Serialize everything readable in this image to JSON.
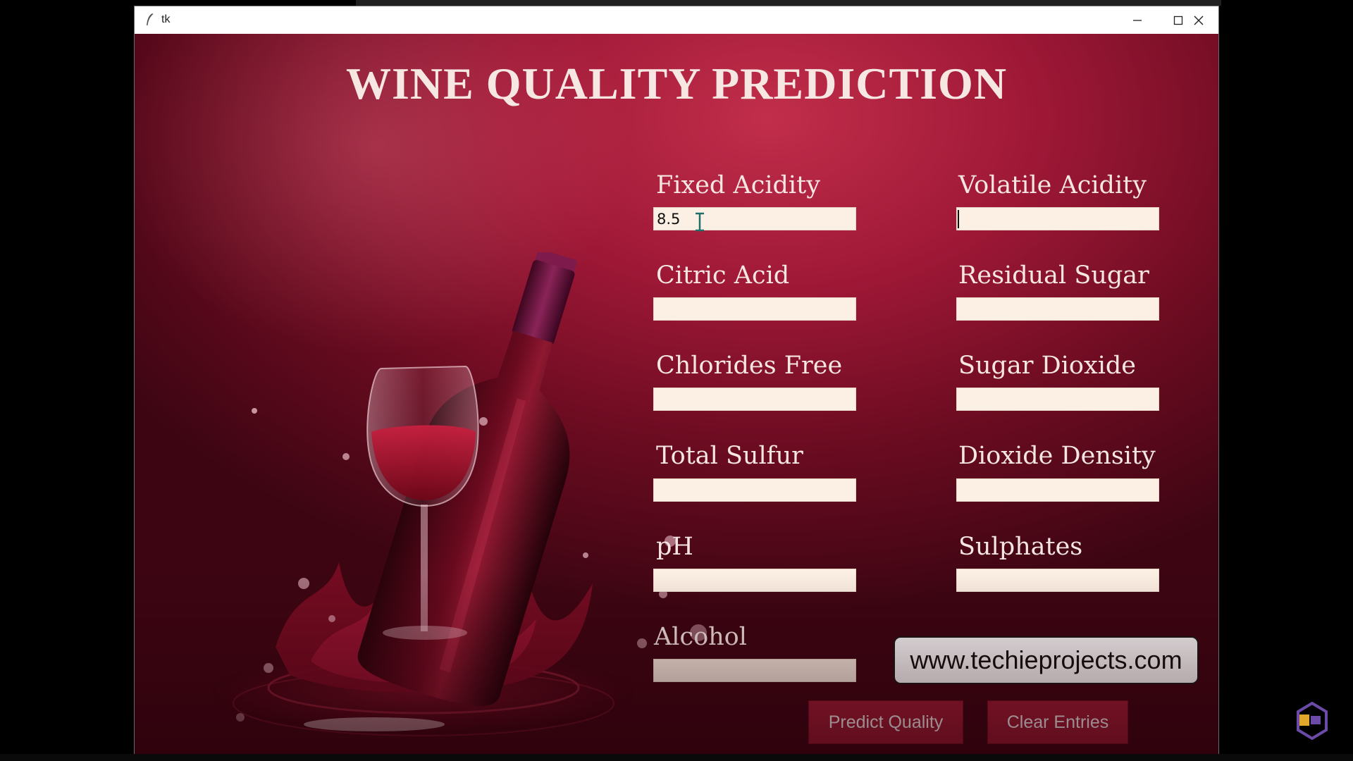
{
  "window": {
    "title": "tk",
    "controls": {
      "minimize": "minimize-icon",
      "maximize": "maximize-icon",
      "close": "close-icon"
    }
  },
  "app": {
    "heading": "WINE QUALITY PREDICTION",
    "fields": [
      {
        "label": "Fixed Acidity",
        "value": "8.5"
      },
      {
        "label": "Volatile Acidity",
        "value": ""
      },
      {
        "label": "Citric Acid",
        "value": ""
      },
      {
        "label": "Residual Sugar",
        "value": ""
      },
      {
        "label": "Chlorides Free",
        "value": ""
      },
      {
        "label": "Sugar Dioxide",
        "value": ""
      },
      {
        "label": "Total Sulfur",
        "value": ""
      },
      {
        "label": "Dioxide Density",
        "value": ""
      },
      {
        "label": "pH",
        "value": ""
      },
      {
        "label": "Sulphates",
        "value": ""
      },
      {
        "label": "Alcohol",
        "value": ""
      }
    ],
    "website": "www.techieprojects.com",
    "buttons": {
      "predict": "Predict Quality",
      "clear": "Clear Entries"
    }
  },
  "colors": {
    "background_accent": "#a01a38",
    "input_fill": "#fcefe3",
    "button_fill": "#a21c35",
    "label_text": "#f5e6e1"
  }
}
